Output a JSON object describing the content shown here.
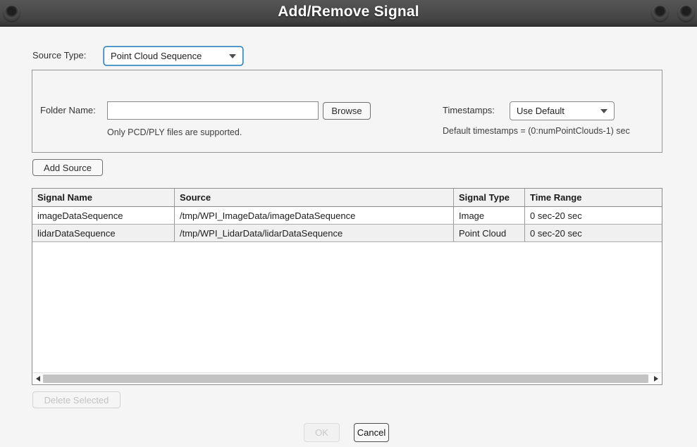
{
  "window": {
    "title": "Add/Remove Signal"
  },
  "source_type": {
    "label": "Source Type:",
    "value": "Point Cloud Sequence"
  },
  "source_panel": {
    "folder_label": "Folder Name:",
    "folder_value": "",
    "browse_button": "Browse",
    "folder_hint": "Only PCD/PLY files are supported.",
    "timestamps_label": "Timestamps:",
    "timestamps_value": "Use Default",
    "timestamps_hint": "Default timestamps = (0:numPointClouds-1) sec"
  },
  "add_source_button": "Add Source",
  "signals_table": {
    "columns": [
      "Signal Name",
      "Source",
      "Signal Type",
      "Time Range"
    ],
    "rows": [
      [
        "imageDataSequence",
        "/tmp/WPI_ImageData/imageDataSequence",
        "Image",
        "0 sec-20 sec"
      ],
      [
        "lidarDataSequence",
        "/tmp/WPI_LidarData/lidarDataSequence",
        "Point Cloud",
        "0 sec-20 sec"
      ]
    ]
  },
  "actions": {
    "delete_selected_button": "Delete Selected",
    "ok_button": "OK",
    "cancel_button": "Cancel"
  },
  "colors": {
    "titlebar": "#454545",
    "focus_accent": "#2e83c0",
    "body_bg": "#f5f5f5",
    "table_header_bg": "#f2f2f2",
    "row_alt_bg": "#f0f0f0"
  }
}
